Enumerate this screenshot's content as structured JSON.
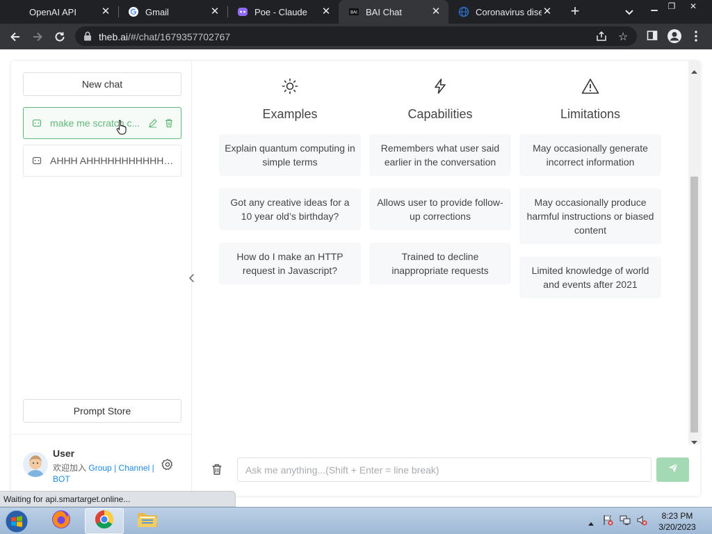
{
  "browser": {
    "tabs": [
      {
        "label": "OpenAI API",
        "icon": "openai-icon"
      },
      {
        "label": "Gmail",
        "icon": "google-icon"
      },
      {
        "label": "Poe - Claude",
        "icon": "poe-icon"
      },
      {
        "label": "BAI Chat",
        "icon": "bai-icon",
        "active": true
      },
      {
        "label": "Coronavirus disea",
        "icon": "globe-icon"
      }
    ],
    "url_host": "theb.ai",
    "url_path": "/#/chat/1679357702767",
    "status_text": "Waiting for api.smartarget.online..."
  },
  "sidebar": {
    "new_chat_label": "New chat",
    "chats": [
      {
        "title": "make me scratch c...",
        "active": true
      },
      {
        "title": "AHHH AHHHHHHHHHHHH...",
        "active": false
      }
    ],
    "prompt_store_label": "Prompt Store",
    "user": {
      "name": "User",
      "join_text": "欢迎加入",
      "group_link": "Group",
      "sep": "|",
      "channel_link": "Channel",
      "bot_link": "BOT"
    }
  },
  "main": {
    "columns": [
      {
        "title": "Examples",
        "icon": "sun-icon",
        "items": [
          "Explain quantum computing in simple terms",
          "Got any creative ideas for a 10 year old’s birthday?",
          "How do I make an HTTP request in Javascript?"
        ]
      },
      {
        "title": "Capabilities",
        "icon": "bolt-icon",
        "items": [
          "Remembers what user said earlier in the conversation",
          "Allows user to provide follow-up corrections",
          "Trained to decline inappropriate requests"
        ]
      },
      {
        "title": "Limitations",
        "icon": "warning-icon",
        "items": [
          "May occasionally generate incorrect information",
          "May occasionally produce harmful instructions or biased content",
          "Limited knowledge of world and events after 2021"
        ]
      }
    ],
    "input_placeholder": "Ask me anything...(Shift + Enter = line break)"
  },
  "taskbar": {
    "time": "8:23 PM",
    "date": "3/20/2023"
  },
  "colors": {
    "accent": "#5fb878",
    "send_button": "#a4d9b5",
    "link": "#1e88e5"
  }
}
